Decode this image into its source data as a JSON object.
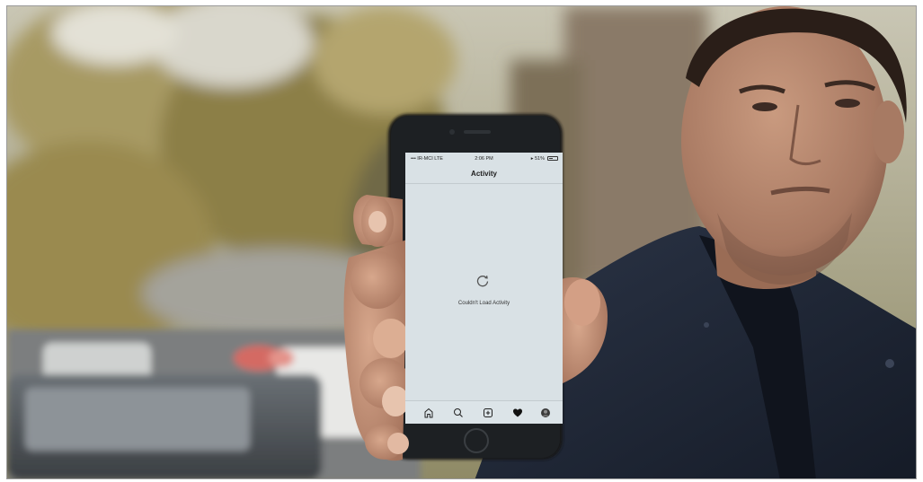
{
  "phone": {
    "status": {
      "carrier": "••• IR-MCI  LTE",
      "time": "2:06 PM",
      "battery": "▸ 51%"
    },
    "screen_title": "Activity",
    "error_message": "Couldn't Load Activity",
    "tabs": [
      "home-icon",
      "search-icon",
      "add-post-icon",
      "heart-icon",
      "profile-icon"
    ]
  },
  "colors": {
    "screen_bg": "#d9e1e5",
    "jacket": "#1f2635",
    "skin": "#b98a71",
    "foliage": "#9c8d52"
  }
}
